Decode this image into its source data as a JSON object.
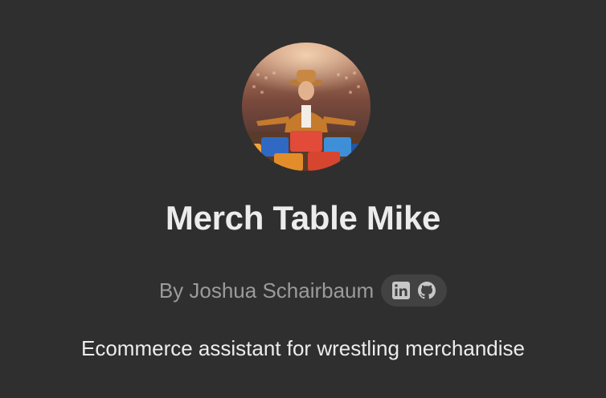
{
  "gpt": {
    "name": "Merch Table Mike",
    "author": "By Joshua Schairbaum",
    "description": "Ecommerce assistant for wrestling merchandise"
  },
  "socials": [
    {
      "icon": "linkedin-icon"
    },
    {
      "icon": "github-icon"
    }
  ]
}
